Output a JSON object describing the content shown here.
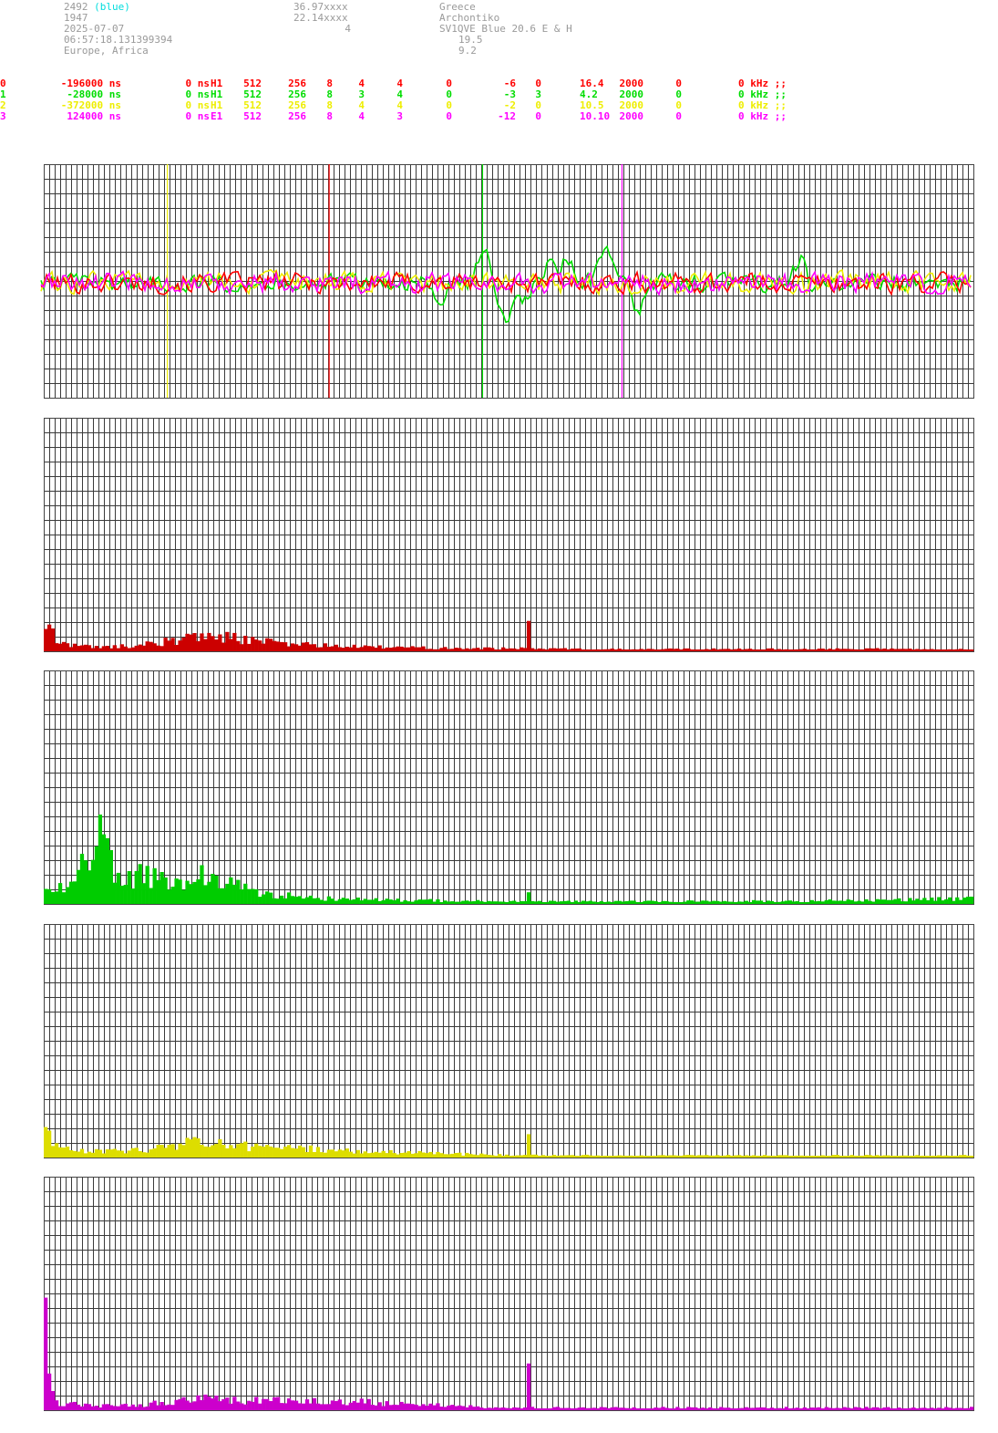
{
  "header": {
    "station_id": "2492",
    "station_tag": "(blue)",
    "number": "1947",
    "date": "2025-07-07",
    "time": "06:57:18.131399394",
    "region": "Europe, Africa",
    "lat": "36.97xxxx",
    "lon": "22.14xxxx",
    "count": "4",
    "country": "Greece",
    "place": "Archontiko",
    "antenna": "SV1QVE Blue 20.6 E & H",
    "val1": "19.5",
    "val2": "9.2"
  },
  "channels": [
    {
      "color": "#ff0000",
      "idx": "0",
      "delay": "-196000 ns",
      "offset": "0 ns",
      "type": "H1",
      "c1": "512",
      "c2": "256",
      "c3": "8",
      "c4": "4",
      "c5": "4",
      "c6": "0",
      "c7": "-6",
      "c8": "0",
      "c9": "16.4",
      "c10": "2000",
      "c11": "0",
      "c12": "0 kHz ;;"
    },
    {
      "color": "#00dd00",
      "idx": "1",
      "delay": "-28000 ns",
      "offset": "0 ns",
      "type": "H1",
      "c1": "512",
      "c2": "256",
      "c3": "8",
      "c4": "3",
      "c5": "4",
      "c6": "0",
      "c7": "-3",
      "c8": "3",
      "c9": "4.2",
      "c10": "2000",
      "c11": "0",
      "c12": "0 kHz ;;"
    },
    {
      "color": "#eeee00",
      "idx": "2",
      "delay": "-372000 ns",
      "offset": "0 ns",
      "type": "H1",
      "c1": "512",
      "c2": "256",
      "c3": "8",
      "c4": "4",
      "c5": "4",
      "c6": "0",
      "c7": "-2",
      "c8": "0",
      "c9": "10.5",
      "c10": "2000",
      "c11": "0",
      "c12": "0 kHz ;;"
    },
    {
      "color": "#ff00ff",
      "idx": "3",
      "delay": "124000 ns",
      "offset": "0 ns",
      "type": "E1",
      "c1": "512",
      "c2": "256",
      "c3": "8",
      "c4": "4",
      "c5": "3",
      "c6": "0",
      "c7": "-12",
      "c8": "0",
      "c9": "10.10",
      "c10": "2000",
      "c11": "0",
      "c12": "0 kHz ;;"
    }
  ],
  "chart_data": [
    {
      "type": "line",
      "name": "waveform",
      "colors": [
        "#ff0000",
        "#00dd00",
        "#eeee00",
        "#ff00ff"
      ],
      "markers": [
        {
          "channel": 2,
          "color": "#eeee00",
          "pos": 0.133
        },
        {
          "channel": 0,
          "color": "#ff0000",
          "pos": 0.307
        },
        {
          "channel": 1,
          "color": "#00dd00",
          "pos": 0.472
        },
        {
          "channel": 3,
          "color": "#ff00ff",
          "pos": 0.622
        }
      ],
      "green_features": [
        {
          "pos": 0.425,
          "amp": -2.1
        },
        {
          "pos": 0.474,
          "amp": 3.8
        },
        {
          "pos": 0.497,
          "amp": -4.5
        },
        {
          "pos": 0.515,
          "amp": -2.2
        },
        {
          "pos": 0.545,
          "amp": 1.7
        },
        {
          "pos": 0.563,
          "amp": 2.5
        },
        {
          "pos": 0.603,
          "amp": 3.4
        },
        {
          "pos": 0.64,
          "amp": -2.8
        },
        {
          "pos": 0.815,
          "amp": 2.8
        },
        {
          "pos": 0.826,
          "amp": -1.7
        }
      ],
      "grid": true
    },
    {
      "type": "bar",
      "name": "spectrum-0",
      "color": "#cc0000",
      "profile": [
        [
          0,
          0.1
        ],
        [
          0.003,
          0.11
        ],
        [
          0.012,
          0.045
        ],
        [
          0.03,
          0.025
        ],
        [
          0.06,
          0.018
        ],
        [
          0.1,
          0.025
        ],
        [
          0.16,
          0.06
        ],
        [
          0.18,
          0.07
        ],
        [
          0.2,
          0.06
        ],
        [
          0.24,
          0.04
        ],
        [
          0.32,
          0.02
        ],
        [
          0.5,
          0.012
        ],
        [
          0.52,
          0.012
        ],
        [
          0.6,
          0.008
        ],
        [
          1,
          0.01
        ]
      ],
      "spike": {
        "pos": 0.52,
        "value": 0.13
      }
    },
    {
      "type": "bar",
      "name": "spectrum-1",
      "color": "#00cc00",
      "profile": [
        [
          0,
          0.06
        ],
        [
          0.01,
          0.05
        ],
        [
          0.02,
          0.08
        ],
        [
          0.03,
          0.12
        ],
        [
          0.045,
          0.2
        ],
        [
          0.055,
          0.3
        ],
        [
          0.06,
          0.42
        ],
        [
          0.065,
          0.25
        ],
        [
          0.075,
          0.1
        ],
        [
          0.1,
          0.12
        ],
        [
          0.13,
          0.1
        ],
        [
          0.17,
          0.12
        ],
        [
          0.18,
          0.1
        ],
        [
          0.2,
          0.08
        ],
        [
          0.24,
          0.04
        ],
        [
          0.32,
          0.02
        ],
        [
          0.5,
          0.01
        ],
        [
          0.65,
          0.01
        ],
        [
          0.8,
          0.012
        ],
        [
          0.9,
          0.015
        ],
        [
          1,
          0.025
        ]
      ],
      "spike": {
        "pos": 0.52,
        "value": 0.05
      }
    },
    {
      "type": "bar",
      "name": "spectrum-2",
      "color": "#dddd00",
      "profile": [
        [
          0,
          0.11
        ],
        [
          0.004,
          0.1
        ],
        [
          0.012,
          0.05
        ],
        [
          0.03,
          0.025
        ],
        [
          0.1,
          0.03
        ],
        [
          0.15,
          0.06
        ],
        [
          0.17,
          0.08
        ],
        [
          0.2,
          0.05
        ],
        [
          0.26,
          0.04
        ],
        [
          0.35,
          0.025
        ],
        [
          0.5,
          0.01
        ],
        [
          0.6,
          0.008
        ],
        [
          1,
          0.008
        ]
      ],
      "spike": {
        "pos": 0.52,
        "value": 0.1
      }
    },
    {
      "type": "bar",
      "name": "spectrum-3",
      "color": "#cc00cc",
      "profile": [
        [
          0,
          0.37
        ],
        [
          0.003,
          0.15
        ],
        [
          0.01,
          0.03
        ],
        [
          0.05,
          0.02
        ],
        [
          0.1,
          0.02
        ],
        [
          0.16,
          0.05
        ],
        [
          0.2,
          0.04
        ],
        [
          0.26,
          0.04
        ],
        [
          0.34,
          0.035
        ],
        [
          0.38,
          0.03
        ],
        [
          0.5,
          0.01
        ],
        [
          1,
          0.01
        ]
      ],
      "spike": {
        "pos": 0.52,
        "value": 0.2
      }
    }
  ]
}
